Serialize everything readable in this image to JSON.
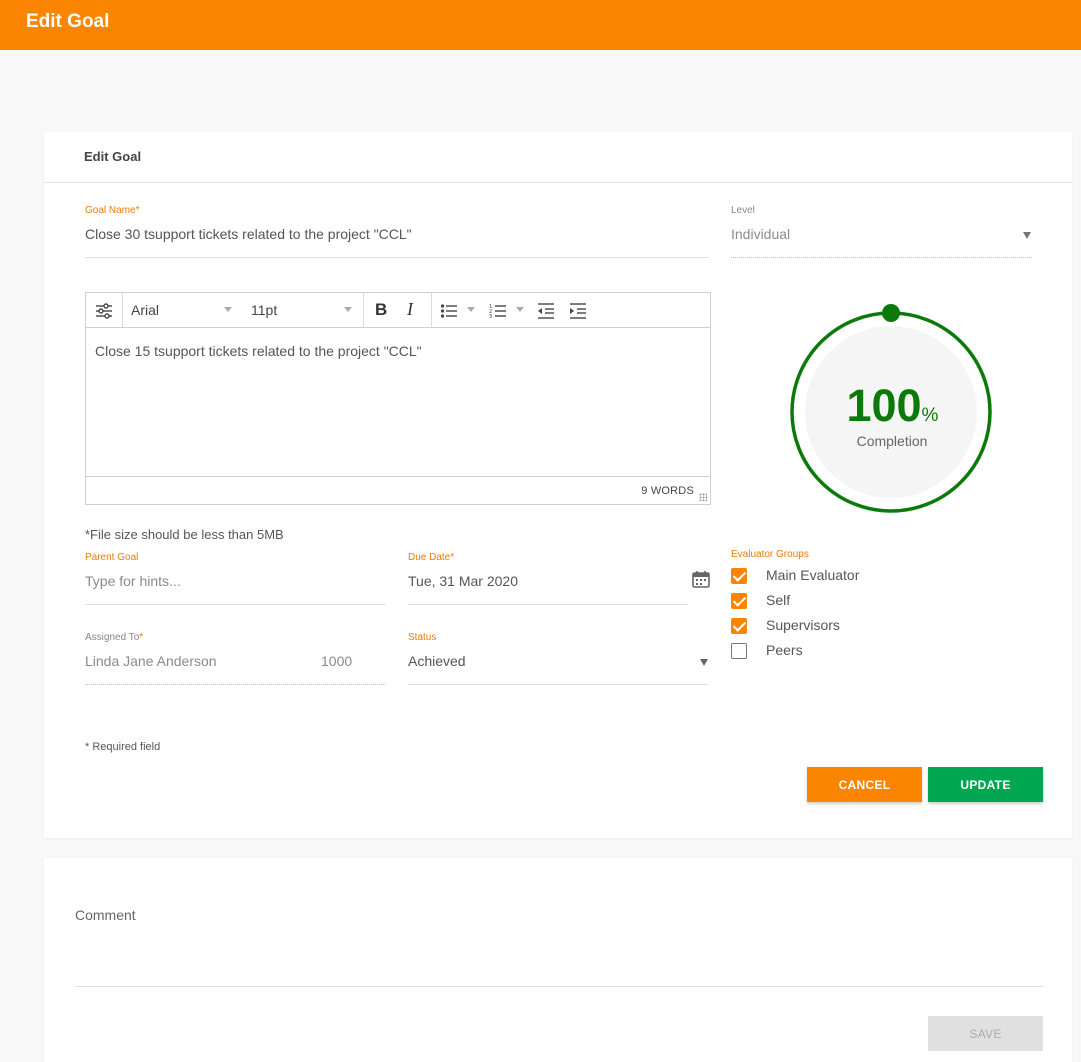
{
  "topbar": {
    "title": "Edit Goal"
  },
  "card": {
    "header": "Edit Goal"
  },
  "goal_name": {
    "label": "Goal Name",
    "required_mark": "*",
    "value": "Close 30 tsupport tickets related to the project \"CCL\""
  },
  "level": {
    "label": "Level",
    "value": "Individual"
  },
  "editor": {
    "font": "Arial",
    "size": "11pt",
    "content": "Close 15 tsupport tickets related to the project \"CCL\"",
    "word_count": "9 WORDS"
  },
  "completion": {
    "value": "100",
    "unit": "%",
    "label": "Completion",
    "fraction": 1.0,
    "color": "#0b7a0b"
  },
  "file_note": "*File size should be less than 5MB",
  "parent_goal": {
    "label": "Parent Goal",
    "placeholder": "Type for hints..."
  },
  "due_date": {
    "label": "Due Date",
    "required_mark": "*",
    "value": "Tue, 31 Mar 2020"
  },
  "assigned_to": {
    "label": "Assigned To",
    "required_mark": "*",
    "name": "Linda Jane Anderson",
    "id": "1000"
  },
  "status": {
    "label": "Status",
    "value": "Achieved"
  },
  "evaluator_groups": {
    "label": "Evaluator Groups",
    "items": [
      {
        "label": "Main Evaluator",
        "checked": true
      },
      {
        "label": "Self",
        "checked": true
      },
      {
        "label": "Supervisors",
        "checked": true
      },
      {
        "label": "Peers",
        "checked": false
      }
    ]
  },
  "required_note": "* Required field",
  "buttons": {
    "cancel": "CANCEL",
    "update": "UPDATE",
    "save": "SAVE"
  },
  "comment": {
    "label": "Comment"
  },
  "colors": {
    "accent": "#fb8500",
    "success": "#00a650",
    "progress": "#0b7a0b"
  }
}
